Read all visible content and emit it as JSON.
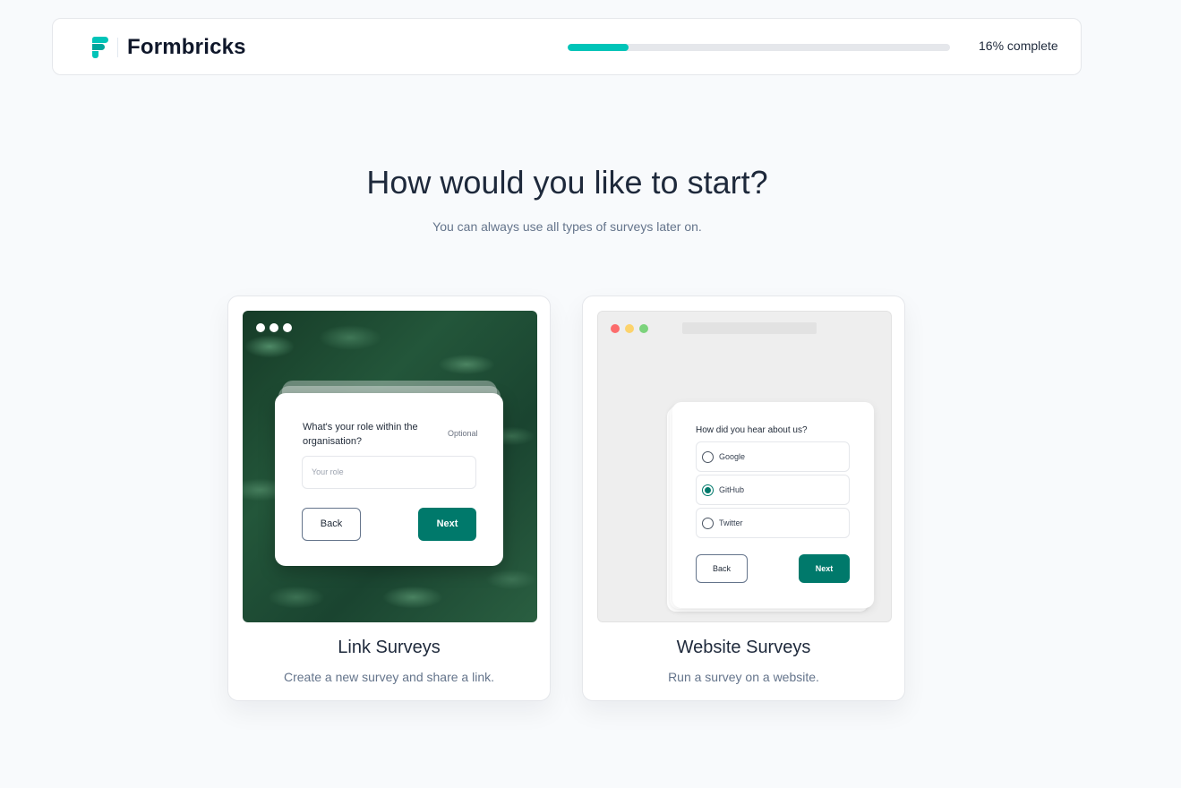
{
  "header": {
    "brand": "Formbricks",
    "progress_fraction": 0.16,
    "progress_text": "16% complete",
    "accent_color": "#00c4b8"
  },
  "main": {
    "title": "How would you like to start?",
    "subtitle": "You can always use all types of surveys later on."
  },
  "cards": {
    "link": {
      "title": "Link Surveys",
      "description": "Create a new survey and share a link.",
      "preview": {
        "question": "What's your role within the organisation?",
        "optional_label": "Optional",
        "input_placeholder": "Your role",
        "back_label": "Back",
        "next_label": "Next"
      }
    },
    "website": {
      "title": "Website Surveys",
      "description": "Run a survey on a website.",
      "preview": {
        "question": "How did you hear about us?",
        "options": [
          "Google",
          "GitHub",
          "Twitter"
        ],
        "selected_option": "GitHub",
        "back_label": "Back",
        "next_label": "Next"
      }
    }
  },
  "colors": {
    "primary_button": "#00796b",
    "page_background": "#f8fafc"
  }
}
